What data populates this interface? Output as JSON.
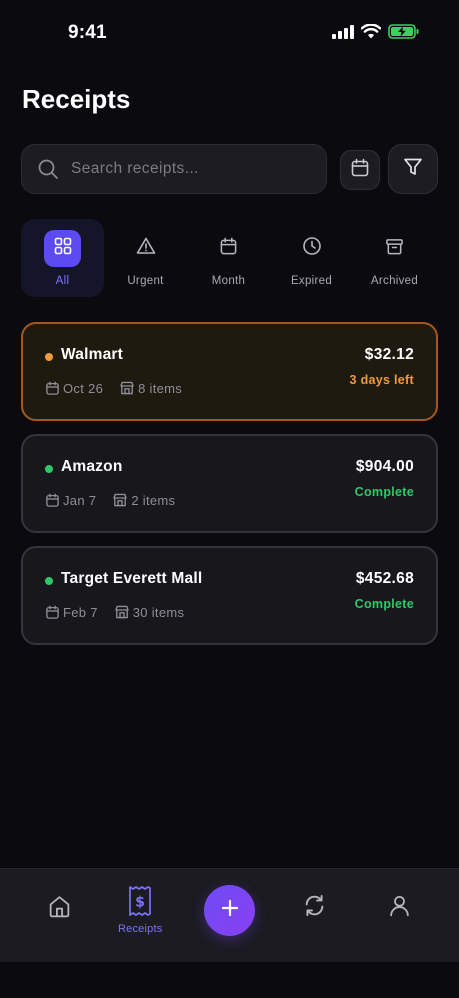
{
  "status_bar": {
    "time": "9:41"
  },
  "header": {
    "title": "Receipts"
  },
  "search": {
    "placeholder": "Search receipts..."
  },
  "tabs": [
    {
      "label": "All",
      "icon": "grid-icon",
      "active": true
    },
    {
      "label": "Urgent",
      "icon": "warning-icon",
      "active": false
    },
    {
      "label": "Month",
      "icon": "calendar-icon",
      "active": false
    },
    {
      "label": "Expired",
      "icon": "clock-icon",
      "active": false
    },
    {
      "label": "Archived",
      "icon": "archive-icon",
      "active": false
    }
  ],
  "receipts": [
    {
      "store": "Walmart",
      "amount": "$32.12",
      "date": "Oct 26",
      "items": "8 items",
      "status": "3 days left",
      "status_color": "#f29a3a",
      "dot_color": "#f29a3a"
    },
    {
      "store": "Amazon",
      "amount": "$904.00",
      "date": "Jan 7",
      "items": "2 items",
      "status": "Complete",
      "status_color": "#2fc76a",
      "dot_color": "#2fc76a"
    },
    {
      "store": "Target Everett Mall",
      "amount": "$452.68",
      "date": "Feb 7",
      "items": "30 items",
      "status": "Complete",
      "status_color": "#2fc76a",
      "dot_color": "#2fc76a"
    }
  ],
  "bottom_nav": {
    "receipts_label": "Receipts",
    "items": [
      "home-icon",
      "receipt-icon",
      "add-icon",
      "sync-icon",
      "profile-icon"
    ]
  },
  "colors": {
    "accent": "#5b4bf0",
    "accent_text": "#7e72f7",
    "urgent": "#f29a3a",
    "complete": "#2fc76a",
    "background": "#0b0b0f"
  }
}
